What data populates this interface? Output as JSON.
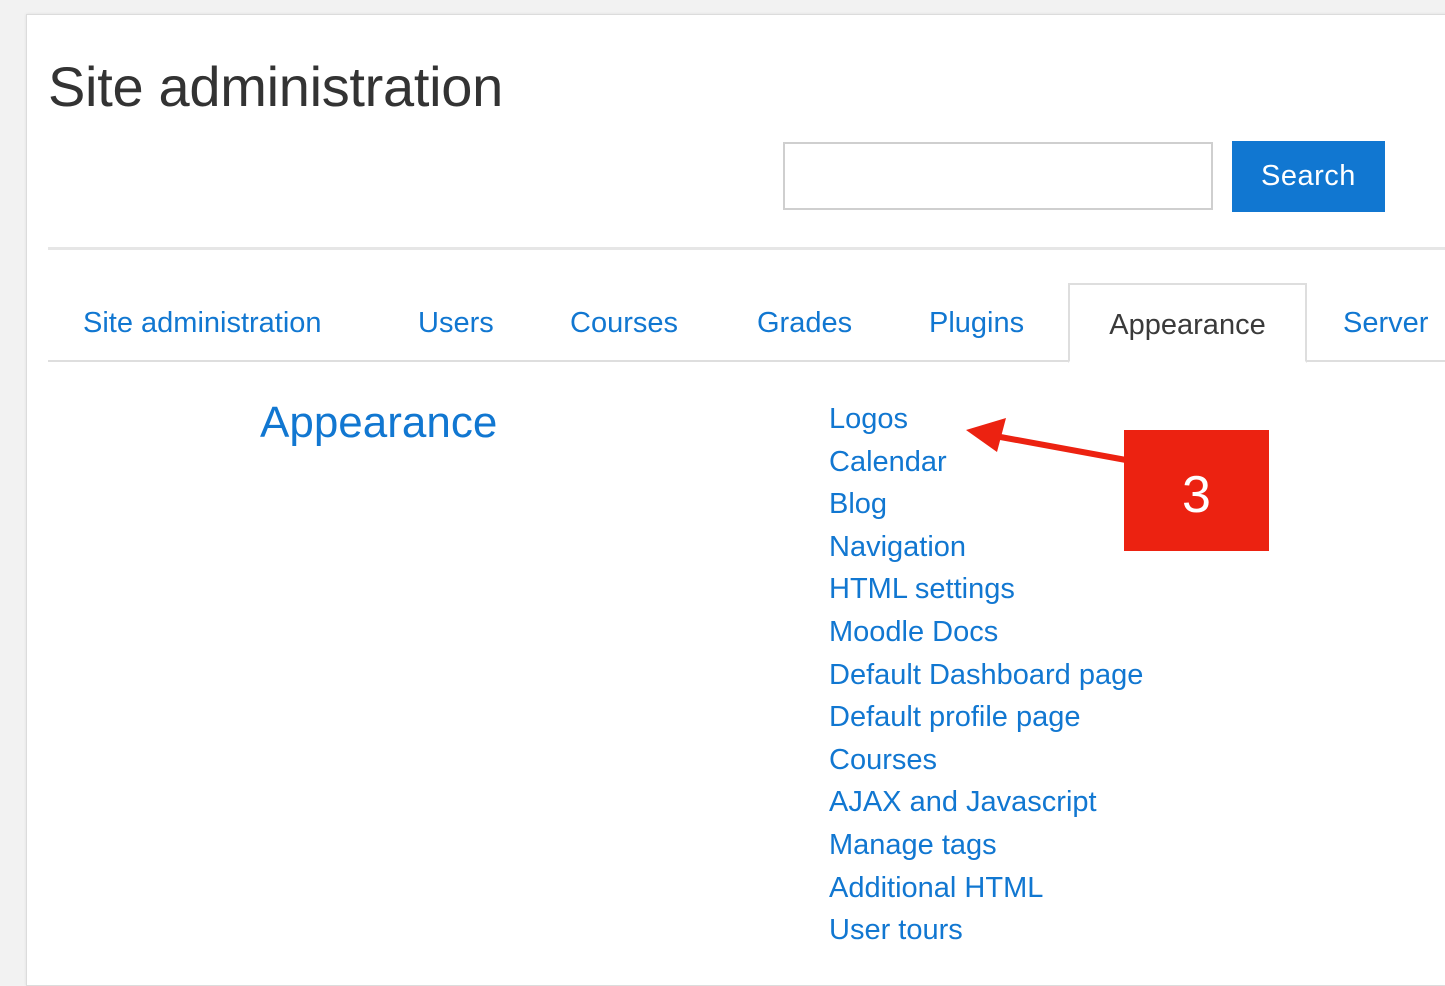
{
  "page": {
    "title": "Site administration"
  },
  "search": {
    "value": "",
    "placeholder": "",
    "button_label": "Search"
  },
  "tabs": [
    {
      "label": "Site administration",
      "active": false
    },
    {
      "label": "Users",
      "active": false
    },
    {
      "label": "Courses",
      "active": false
    },
    {
      "label": "Grades",
      "active": false
    },
    {
      "label": "Plugins",
      "active": false
    },
    {
      "label": "Appearance",
      "active": true
    },
    {
      "label": "Server",
      "active": false
    }
  ],
  "section": {
    "heading": "Appearance",
    "links": [
      "Logos",
      "Calendar",
      "Blog",
      "Navigation",
      "HTML settings",
      "Moodle Docs",
      "Default Dashboard page",
      "Default profile page",
      "Courses",
      "AJAX and Javascript",
      "Manage tags",
      "Additional HTML",
      "User tours"
    ]
  },
  "annotation": {
    "label": "3",
    "color": "#ec2211",
    "points_to": "Logos"
  },
  "colors": {
    "accent": "#1177d1",
    "text": "#333333",
    "background": "#ffffff"
  }
}
